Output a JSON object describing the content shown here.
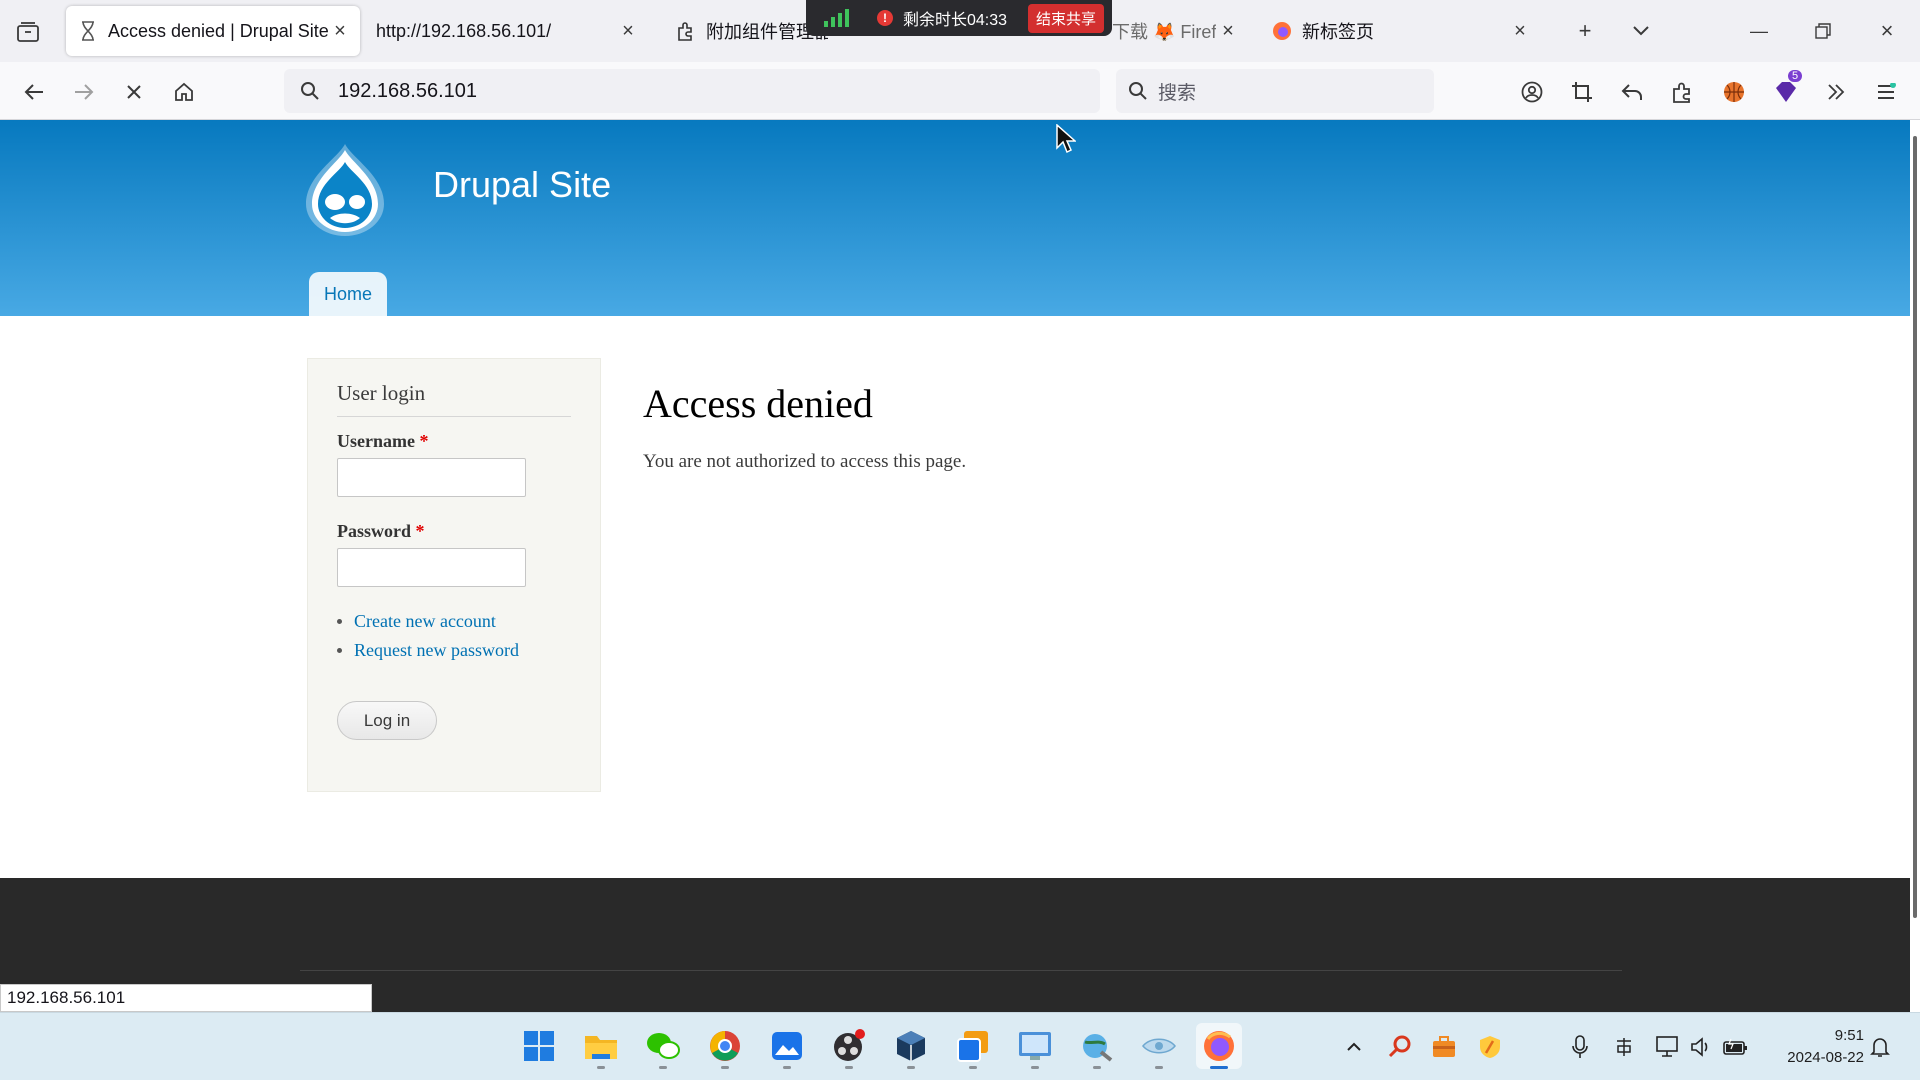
{
  "browser": {
    "tabs": [
      {
        "title": "Access denied | Drupal Site",
        "icon": "hourglass-icon",
        "active": true
      },
      {
        "title": "http://192.168.56.101/",
        "icon": "",
        "active": false
      },
      {
        "title": "附加组件管理器",
        "icon": "puzzle-icon",
        "active": false
      },
      {
        "title": "下载 🦊 Firef",
        "icon": "",
        "active": false
      },
      {
        "title": "新标签页",
        "icon": "firefox-icon",
        "active": false
      }
    ],
    "url": "192.168.56.101",
    "search_placeholder": "搜索",
    "extension_badge": "5"
  },
  "share_overlay": {
    "remaining": "剩余时长04:33",
    "end_share": "结束共享"
  },
  "site": {
    "name": "Drupal Site",
    "menu": {
      "home": "Home"
    }
  },
  "login_block": {
    "title": "User login",
    "username_label": "Username",
    "password_label": "Password",
    "required_mark": "*",
    "links": {
      "create": "Create new account",
      "request": "Request new password"
    },
    "submit": "Log in"
  },
  "content": {
    "title": "Access denied",
    "message": "You are not authorized to access this page."
  },
  "status_bar": {
    "url": "192.168.56.101"
  },
  "taskbar": {
    "time": "9:51",
    "date": "2024-08-22"
  }
}
